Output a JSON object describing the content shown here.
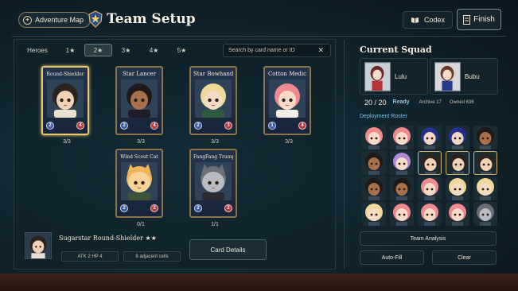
{
  "header": {
    "map_label": "Adventure Map",
    "title": "Team Setup",
    "codex_label": "Codex",
    "finish_label": "Finish"
  },
  "filters": {
    "tabs": [
      "Heroes",
      "1★",
      "2★",
      "3★",
      "4★",
      "5★"
    ],
    "active_index": 2,
    "search_placeholder": "Search by card name or ID"
  },
  "cards": [
    {
      "name": "Round-Shielder",
      "blue": "2",
      "red": "4",
      "count": "3/3",
      "selected": true,
      "hair": "#2b2320",
      "skin": "#f2d2b6",
      "outfit": "#e8e0d0"
    },
    {
      "name": "Star Lancer",
      "blue": "2",
      "red": "4",
      "count": "3/3",
      "selected": false,
      "hair": "#1e1a1c",
      "skin": "#a8714c",
      "outfit": "#1e1c28"
    },
    {
      "name": "Star Bowhand",
      "blue": "2",
      "red": "3",
      "count": "3/3",
      "selected": false,
      "hair": "#f0d898",
      "skin": "#f4dcc4",
      "outfit": "#2e5a40"
    },
    {
      "name": "Cotton Medic",
      "blue": "1",
      "red": "4",
      "count": "3/3",
      "selected": false,
      "hair": "#f08a90",
      "skin": "#f6dcc8",
      "outfit": "#f2eee6"
    },
    {
      "name": "Wind Scout Cat",
      "blue": "2",
      "red": "2",
      "count": "0/1",
      "selected": false,
      "hair": "#f2b458",
      "skin": "#f8d498",
      "outfit": "#3c5438"
    },
    {
      "name": "FangFang Trumpeter",
      "blue": "2",
      "red": "2",
      "count": "1/1",
      "selected": false,
      "hair": "#6a6e76",
      "skin": "#b8bcc2",
      "outfit": "#2a2a32"
    }
  ],
  "selected_info": {
    "name": "Sugarstar Round-Shielder ★★",
    "stats": "ATK 2  HP 4",
    "cells": "8 adjacent cells",
    "details_label": "Card Details"
  },
  "squad": {
    "title": "Current Squad",
    "members": [
      {
        "name": "Lulu"
      },
      {
        "name": "Bubu"
      }
    ],
    "count": "20 / 20",
    "status": "Ready",
    "archive": "Archive 17",
    "owned": "Owned 636"
  },
  "roster": {
    "label": "Deployment Roster",
    "chars": [
      {
        "hair": "#f08a90",
        "skin": "#f6dcc8"
      },
      {
        "hair": "#f08a90",
        "skin": "#f6dcc8"
      },
      {
        "hair": "#24308a",
        "skin": "#f2d8c4"
      },
      {
        "hair": "#24308a",
        "skin": "#f2d8c4"
      },
      {
        "hair": "#1e1a1c",
        "skin": "#a8714c"
      },
      {
        "hair": "#1e1a1c",
        "skin": "#a8714c"
      },
      {
        "hair": "#b08ad8",
        "skin": "#f6dcc8"
      },
      {
        "hair": "#2b2320",
        "skin": "#f2d2b6"
      },
      {
        "hair": "#2b2320",
        "skin": "#f2d2b6"
      },
      {
        "hair": "#2b2320",
        "skin": "#f2d2b6"
      },
      {
        "hair": "#1e1a1c",
        "skin": "#a8714c"
      },
      {
        "hair": "#1e1a1c",
        "skin": "#a8714c"
      },
      {
        "hair": "#f08a90",
        "skin": "#f6dcc8"
      },
      {
        "hair": "#f0d898",
        "skin": "#f4dcc4"
      },
      {
        "hair": "#f0d898",
        "skin": "#f4dcc4"
      },
      {
        "hair": "#f0d898",
        "skin": "#f4dcc4"
      },
      {
        "hair": "#f08a90",
        "skin": "#f6dcc8"
      },
      {
        "hair": "#f08a90",
        "skin": "#f6dcc8"
      },
      {
        "hair": "#f08a90",
        "skin": "#f6dcc8"
      },
      {
        "hair": "#6a6e76",
        "skin": "#b8bcc2"
      }
    ],
    "highlighted": [
      7,
      8,
      9
    ]
  },
  "actions": {
    "analysis_label": "Team Analysis",
    "autofill_label": "Auto-Fill",
    "clear_label": "Clear"
  }
}
